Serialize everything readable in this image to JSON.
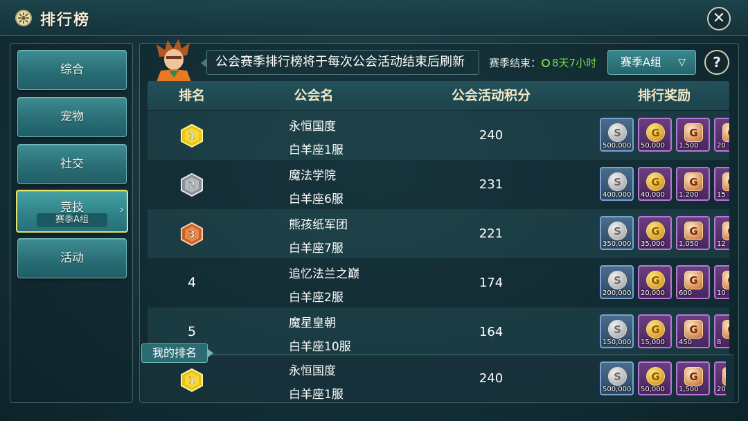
{
  "header": {
    "title": "排行榜",
    "icon": "badge-icon"
  },
  "sidebar": {
    "items": [
      {
        "label": "综合"
      },
      {
        "label": "宠物"
      },
      {
        "label": "社交"
      },
      {
        "label": "竞技",
        "sub": "赛季A组",
        "active": true
      },
      {
        "label": "活动"
      }
    ]
  },
  "notice": "公会赛季排行榜将于每次公会活动结束后刷新",
  "season": {
    "label": "赛季结束：",
    "time": "8天7小时",
    "select": "赛季A组"
  },
  "table": {
    "headers": [
      "排名",
      "公会名",
      "公会活动积分",
      "排行奖励"
    ],
    "rows": [
      {
        "rank": "1",
        "name": "永恒国度",
        "server": "白羊座1服",
        "score": "240",
        "rewards": [
          "500,000",
          "50,000",
          "1,500",
          "20"
        ]
      },
      {
        "rank": "2",
        "name": "魔法学院",
        "server": "白羊座6服",
        "score": "231",
        "rewards": [
          "400,000",
          "40,000",
          "1,200",
          "15"
        ]
      },
      {
        "rank": "3",
        "name": "熊孩纸军团",
        "server": "白羊座7服",
        "score": "221",
        "rewards": [
          "350,000",
          "35,000",
          "1,050",
          "12"
        ]
      },
      {
        "rank": "4",
        "name": "追忆法兰之巅",
        "server": "白羊座2服",
        "score": "174",
        "rewards": [
          "200,000",
          "20,000",
          "600",
          "10"
        ]
      },
      {
        "rank": "5",
        "name": "魔星皇朝",
        "server": "白羊座10服",
        "score": "164",
        "rewards": [
          "150,000",
          "15,000",
          "450",
          "8"
        ]
      }
    ]
  },
  "my_rank": {
    "tag": "我的排名",
    "rank": "1",
    "name": "永恒国度",
    "server": "白羊座1服",
    "score": "240",
    "rewards": [
      "500,000",
      "50,000",
      "1,500",
      "20"
    ]
  },
  "colors": {
    "accent": "#e8e26a",
    "timer": "#7ad84a",
    "header_text": "#f2e8c6"
  }
}
